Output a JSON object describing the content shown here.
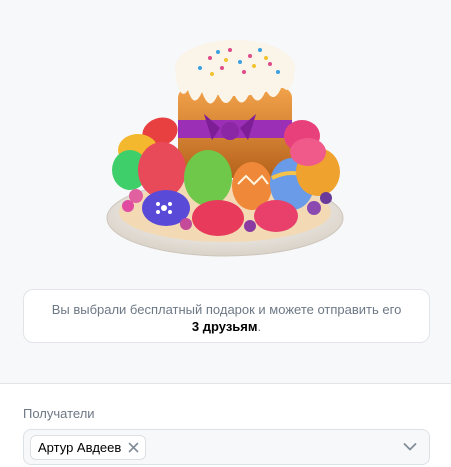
{
  "gift": {
    "image_name": "easter-cake-gift"
  },
  "info": {
    "text": "Вы выбрали бесплатный подарок и можете отправить его",
    "highlight": "3 друзьям",
    "suffix": "."
  },
  "recipients": {
    "label": "Получатели",
    "chips": [
      {
        "name": "Артур Авдеев"
      }
    ]
  },
  "icons": {
    "remove": "close-icon",
    "dropdown": "chevron-down-icon"
  },
  "colors": {
    "secondary_text": "#6d7885",
    "border": "#dce1e6",
    "background": "#f7f8fa"
  }
}
